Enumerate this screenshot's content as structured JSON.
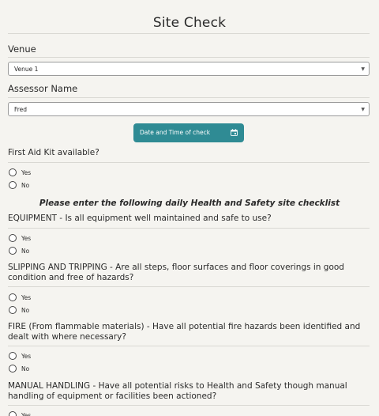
{
  "title": "Site Check",
  "venue": {
    "label": "Venue",
    "selected": "Venue 1"
  },
  "assessor": {
    "label": "Assessor Name",
    "selected": "Fred"
  },
  "date_button": {
    "label": "Date and Time of check",
    "icon": "calendar-icon"
  },
  "options": {
    "yes": "Yes",
    "no": "No"
  },
  "first_aid": {
    "question": "First Aid Kit available?"
  },
  "instruction": "Please enter the following daily Health and Safety site checklist",
  "questions": [
    {
      "text": "EQUIPMENT - Is all equipment well maintained and safe to use?"
    },
    {
      "text": "SLIPPING AND TRIPPING - Are all steps, floor surfaces and floor coverings in good condition and free of hazards?"
    },
    {
      "text": "FIRE (From flammable materials) - Have all potential fire hazards been identified and dealt with where necessary?"
    },
    {
      "text": "MANUAL HANDLING - Have all potential risks to Health and Safety though manual handling of equipment or facilities been actioned?"
    }
  ],
  "colors": {
    "accent": "#2f8b94",
    "background": "#f5f4f0"
  }
}
